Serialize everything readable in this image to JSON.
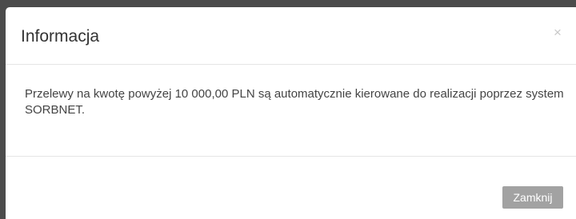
{
  "modal": {
    "title": "Informacja",
    "close_icon": "×",
    "message": "Przelewy na kwotę powyżej 10 000,00 PLN są automatycznie kierowane do realizacji poprzez system SORBNET.",
    "footer": {
      "close_label": "Zamknij"
    }
  },
  "colors": {
    "backdrop": "#4b4b4b",
    "modal_background": "#ffffff",
    "button_background": "#a2a2a2",
    "divider": "#e5e5e5"
  }
}
